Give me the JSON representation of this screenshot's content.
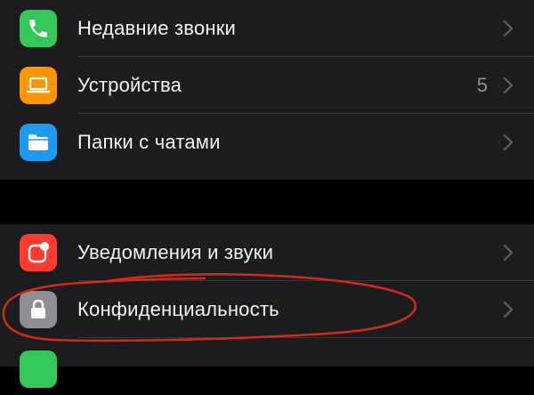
{
  "settings": {
    "group1": [
      {
        "label": "Недавние звонки",
        "icon": "phone-icon",
        "color": "#34c759",
        "count": ""
      },
      {
        "label": "Устройства",
        "icon": "laptop-icon",
        "color": "#ff9500",
        "count": "5"
      },
      {
        "label": "Папки с чатами",
        "icon": "folder-icon",
        "color": "#1e9bf0",
        "count": ""
      }
    ],
    "group2": [
      {
        "label": "Уведомления и звуки",
        "icon": "notification-icon",
        "color": "#ff3b30"
      },
      {
        "label": "Конфиденциальность",
        "icon": "lock-icon",
        "color": "#8e8e93"
      }
    ]
  },
  "annotation": {
    "color": "#d22a1a",
    "target": "Конфиденциальность"
  }
}
